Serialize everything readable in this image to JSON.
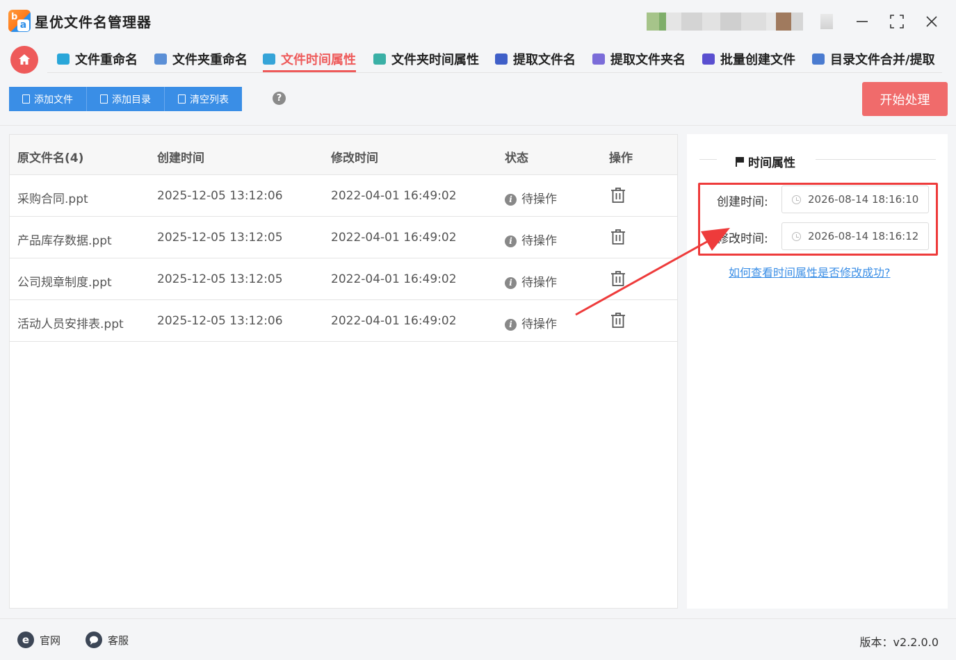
{
  "app": {
    "title": "星优文件名管理器"
  },
  "tabs": [
    {
      "label": "文件重命名",
      "color": "#29a6d9"
    },
    {
      "label": "文件夹重命名",
      "color": "#5b8fd6"
    },
    {
      "label": "文件时间属性",
      "color": "#35a4d8"
    },
    {
      "label": "文件夹时间属性",
      "color": "#3ab0a6"
    },
    {
      "label": "提取文件名",
      "color": "#3f5fc8"
    },
    {
      "label": "提取文件夹名",
      "color": "#7b6cd9"
    },
    {
      "label": "批量创建文件",
      "color": "#5a4fd0"
    },
    {
      "label": "目录文件合并/提取",
      "color": "#4a7bd0"
    }
  ],
  "toolbar": {
    "add_file": "添加文件",
    "add_dir": "添加目录",
    "clear_list": "清空列表",
    "help": "?",
    "start": "开始处理"
  },
  "table": {
    "headers": [
      "原文件名(4)",
      "创建时间",
      "修改时间",
      "状态",
      "操作"
    ],
    "rows": [
      {
        "name": "采购合同.ppt",
        "created": "2025-12-05 13:12:06",
        "modified": "2022-04-01 16:49:02",
        "status": "待操作"
      },
      {
        "name": "产品库存数据.ppt",
        "created": "2025-12-05 13:12:05",
        "modified": "2022-04-01 16:49:02",
        "status": "待操作"
      },
      {
        "name": "公司规章制度.ppt",
        "created": "2025-12-05 13:12:05",
        "modified": "2022-04-01 16:49:02",
        "status": "待操作"
      },
      {
        "name": "活动人员安排表.ppt",
        "created": "2025-12-05 13:12:06",
        "modified": "2022-04-01 16:49:02",
        "status": "待操作"
      }
    ]
  },
  "panel": {
    "title": "时间属性",
    "created_label": "创建时间:",
    "created_value": "2026-08-14 18:16:10",
    "modified_label": "修改时间:",
    "modified_value": "2026-08-14 18:16:12",
    "help_link": "如何查看时间属性是否修改成功?"
  },
  "footer": {
    "website": "官网",
    "support": "客服",
    "version": "版本：v2.2.0.0"
  },
  "colors": {
    "accent_red": "#ee5a5a",
    "primary_blue": "#3a8ee6",
    "highlight_box": "#ee3b3b"
  }
}
